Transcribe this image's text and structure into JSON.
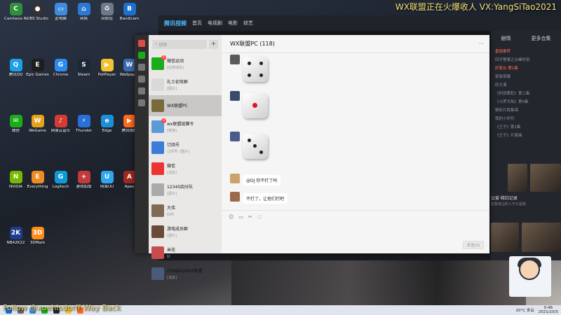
{
  "overlay": {
    "top_text": "WX联盟正在火爆收人  VX:YangSiTao2021",
    "bottom_text": "Follow @xuehisdorff Way Back"
  },
  "desktop_icons": [
    {
      "label": "Camtasia Recorder",
      "color": "#2f8f3a",
      "glyph": "C"
    },
    {
      "label": "OBS Studio",
      "color": "#303236",
      "glyph": "●"
    },
    {
      "label": "此电脑",
      "color": "#3f8be0",
      "glyph": "▭"
    },
    {
      "label": "网络",
      "color": "#2b79d4",
      "glyph": "⌂"
    },
    {
      "label": "回收站",
      "color": "#6e7a87",
      "glyph": "♻"
    },
    {
      "label": "Bandicam",
      "color": "#1f6fcc",
      "glyph": "B"
    },
    {
      "label": "腾讯QQ",
      "color": "#1aa0e8",
      "glyph": "Q"
    },
    {
      "label": "Epic Games",
      "color": "#1e1e1e",
      "glyph": "E"
    },
    {
      "label": "Chrome",
      "color": "#2d8cf0",
      "glyph": "G"
    },
    {
      "label": "Steam",
      "color": "#1b2838",
      "glyph": "S"
    },
    {
      "label": "PotPlayer",
      "color": "#f2c230",
      "glyph": "▶"
    },
    {
      "label": "Wallpaper",
      "color": "#3b6cb2",
      "glyph": "W"
    },
    {
      "label": "微信",
      "color": "#1aad19",
      "glyph": "✉"
    },
    {
      "label": "WeGame",
      "color": "#e6a21a",
      "glyph": "W"
    },
    {
      "label": "网易云音乐",
      "color": "#d43c33",
      "glyph": "♪"
    },
    {
      "label": "Thunder",
      "color": "#2a6fd6",
      "glyph": "⚡"
    },
    {
      "label": "Edge",
      "color": "#1c8fd8",
      "glyph": "e"
    },
    {
      "label": "腾讯视频",
      "color": "#ff6a1a",
      "glyph": "▶"
    },
    {
      "label": "NVIDIA",
      "color": "#76b900",
      "glyph": "N"
    },
    {
      "label": "Everything",
      "color": "#f08a24",
      "glyph": "E"
    },
    {
      "label": "Logitech",
      "color": "#0e9ad8",
      "glyph": "G"
    },
    {
      "label": "游戏加加",
      "color": "#c23a3a",
      "glyph": "+"
    },
    {
      "label": "网易UU",
      "color": "#2ea6f0",
      "glyph": "U"
    },
    {
      "label": "Apex",
      "color": "#a3281e",
      "glyph": "A"
    },
    {
      "label": "NBA2K22",
      "color": "#1f3b8b",
      "glyph": "2K"
    },
    {
      "label": "3DMark",
      "color": "#ff8b1a",
      "glyph": "3D"
    }
  ],
  "video_site": {
    "logo": "腾讯视频",
    "nav": [
      "首页",
      "电视剧",
      "电影",
      "综艺"
    ],
    "panel_tabs": [
      "剧情",
      "更多合集"
    ],
    "panel_title": "重磅推荐",
    "panel_items": [
      "四平警事之尖峰时刻",
      "好家伙 第1集",
      "家族荣耀",
      "叹大漠",
      "《刑侦罪犯》第二集",
      "《斗罗大陆》第9集",
      "精彩片段集锦",
      "我的小时代",
      "《王子》第1集",
      "《王子》片尾曲"
    ],
    "thumb_caption": "父爱·释囚记录",
    "thumb_sub": "在我身边的人不只是我"
  },
  "wechat": {
    "search_placeholder": "搜索",
    "plus": "+",
    "conversations": [
      {
        "name": "微信运动",
        "preview": "[应用消息]",
        "color": "#1aad19",
        "badge": "1"
      },
      {
        "name": "礼士初攻群",
        "preview": "[图片]",
        "color": "#d9d9d9",
        "badge": ""
      },
      {
        "name": "WX联盟PC",
        "preview": "",
        "color": "#7a6a3a",
        "badge": ""
      },
      {
        "name": "wx联盟组赛令",
        "preview": "[链接]",
        "color": "#5b9bd5",
        "badge": "3"
      },
      {
        "name": "订阅号",
        "preview": "订阅号: [图片]",
        "color": "#3b7cd8",
        "badge": ""
      },
      {
        "name": "微信",
        "preview": "[消息]",
        "color": "#ee3333",
        "badge": ""
      },
      {
        "name": "12345四分队",
        "preview": "[图片]",
        "color": "#aaa",
        "badge": ""
      },
      {
        "name": "大伟",
        "preview": "好的",
        "color": "#7f6a55",
        "badge": ""
      },
      {
        "name": "游戏成员群",
        "preview": "[图片]",
        "color": "#6a4a3a",
        "badge": ""
      },
      {
        "name": "米花",
        "preview": "好",
        "color": "#c94c4c",
        "badge": ""
      },
      {
        "name": "(P)NBA2KWX联盟",
        "preview": "[消息]",
        "color": "#4a5a7a",
        "badge": ""
      }
    ],
    "chat_title": "WX联盟PC (118)",
    "messages": [
      {
        "sender": "",
        "type": "dice",
        "pips": 4
      },
      {
        "sender": "",
        "type": "dice",
        "pips": 1
      },
      {
        "sender": "",
        "type": "dice",
        "pips": 3
      },
      {
        "sender": "",
        "type": "text",
        "text": "@DJ 你不打了吗"
      },
      {
        "sender": "",
        "type": "text",
        "text": "不打了，让他们打吧"
      }
    ],
    "send_label": "发送(S)"
  },
  "taskbar": {
    "temp": "20°C 多云",
    "time": "0:46",
    "date": "2021/10/5"
  }
}
